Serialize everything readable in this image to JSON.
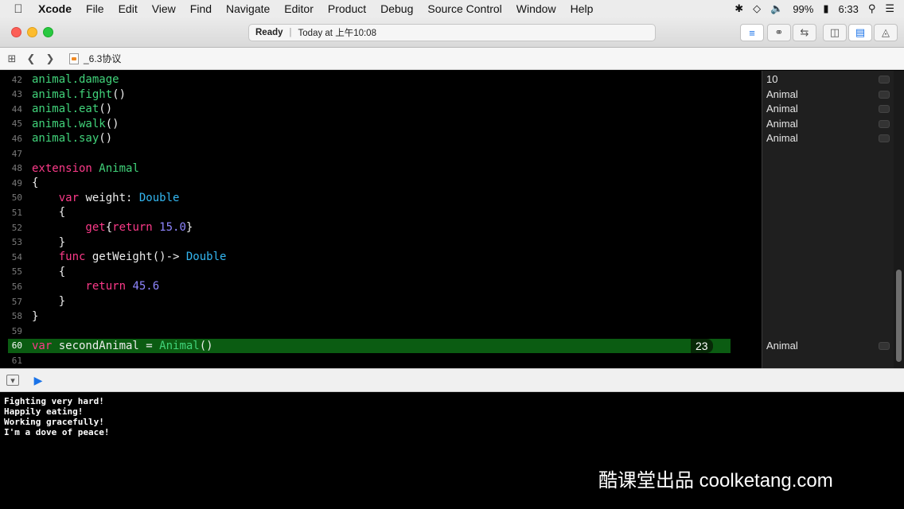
{
  "menubar": {
    "items": [
      "Xcode",
      "File",
      "Edit",
      "View",
      "Find",
      "Navigate",
      "Editor",
      "Product",
      "Debug",
      "Source Control",
      "Window",
      "Help"
    ],
    "battery": "99%",
    "time": "6:33"
  },
  "toolbar": {
    "status": "Ready",
    "timestamp": "Today at 上午10:08"
  },
  "jumpbar": {
    "filename": "_6.3协议"
  },
  "editor": {
    "lines": [
      {
        "num": "42",
        "tokens": [
          {
            "t": "animal.damage",
            "c": "t-prop"
          }
        ]
      },
      {
        "num": "43",
        "tokens": [
          {
            "t": "animal.fight",
            "c": "t-prop"
          },
          {
            "t": "()",
            "c": "t-plain"
          }
        ]
      },
      {
        "num": "44",
        "tokens": [
          {
            "t": "animal.eat",
            "c": "t-prop"
          },
          {
            "t": "()",
            "c": "t-plain"
          }
        ]
      },
      {
        "num": "45",
        "tokens": [
          {
            "t": "animal.walk",
            "c": "t-prop"
          },
          {
            "t": "()",
            "c": "t-plain"
          }
        ]
      },
      {
        "num": "46",
        "tokens": [
          {
            "t": "animal.say",
            "c": "t-prop"
          },
          {
            "t": "()",
            "c": "t-plain"
          }
        ]
      },
      {
        "num": "47",
        "tokens": []
      },
      {
        "num": "48",
        "tokens": [
          {
            "t": "extension ",
            "c": "t-kw"
          },
          {
            "t": "Animal",
            "c": "t-prop"
          }
        ]
      },
      {
        "num": "49",
        "tokens": [
          {
            "t": "{",
            "c": "t-plain"
          }
        ]
      },
      {
        "num": "50",
        "tokens": [
          {
            "t": "    var ",
            "c": "t-kw"
          },
          {
            "t": "weight: ",
            "c": "t-plain"
          },
          {
            "t": "Double",
            "c": "t-type"
          }
        ]
      },
      {
        "num": "51",
        "tokens": [
          {
            "t": "    {",
            "c": "t-plain"
          }
        ]
      },
      {
        "num": "52",
        "tokens": [
          {
            "t": "        get",
            "c": "t-kw"
          },
          {
            "t": "{",
            "c": "t-plain"
          },
          {
            "t": "return ",
            "c": "t-kw"
          },
          {
            "t": "15.0",
            "c": "t-num"
          },
          {
            "t": "}",
            "c": "t-plain"
          }
        ]
      },
      {
        "num": "53",
        "tokens": [
          {
            "t": "    }",
            "c": "t-plain"
          }
        ]
      },
      {
        "num": "54",
        "tokens": [
          {
            "t": "    func ",
            "c": "t-kw"
          },
          {
            "t": "getWeight()-> ",
            "c": "t-plain"
          },
          {
            "t": "Double",
            "c": "t-type"
          }
        ]
      },
      {
        "num": "55",
        "tokens": [
          {
            "t": "    {",
            "c": "t-plain"
          }
        ]
      },
      {
        "num": "56",
        "tokens": [
          {
            "t": "        return ",
            "c": "t-kw"
          },
          {
            "t": "45.6",
            "c": "t-num"
          }
        ]
      },
      {
        "num": "57",
        "tokens": [
          {
            "t": "    }",
            "c": "t-plain"
          }
        ]
      },
      {
        "num": "58",
        "tokens": [
          {
            "t": "}",
            "c": "t-plain"
          }
        ]
      },
      {
        "num": "59",
        "tokens": []
      },
      {
        "num": "60",
        "tokens": [
          {
            "t": "var ",
            "c": "t-kw"
          },
          {
            "t": "secondAnimal = ",
            "c": "t-plain"
          },
          {
            "t": "Animal",
            "c": "t-prop"
          },
          {
            "t": "()",
            "c": "t-plain"
          }
        ],
        "highlight": true,
        "badge": "23"
      },
      {
        "num": "61",
        "tokens": []
      }
    ]
  },
  "results": [
    {
      "line": "42",
      "value": "10"
    },
    {
      "line": "43",
      "value": "Animal"
    },
    {
      "line": "44",
      "value": "Animal"
    },
    {
      "line": "45",
      "value": "Animal"
    },
    {
      "line": "46",
      "value": "Animal"
    },
    {
      "line": "60",
      "value": "Animal"
    }
  ],
  "console": {
    "lines": [
      "Fighting very hard!",
      "Happily eating!",
      "Working gracefully!",
      "I'm a dove of peace!"
    ]
  },
  "watermark": "酷课堂出品 coolketang.com",
  "colors": {
    "keyword": "#fc3a89",
    "identifier": "#41d37a",
    "type": "#33b6f0",
    "number": "#8f86ff",
    "current_line": "#0b5c12"
  }
}
